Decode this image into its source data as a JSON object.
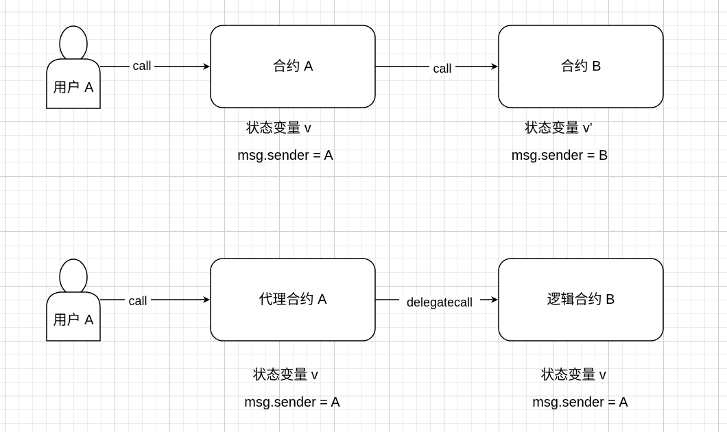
{
  "top_row": {
    "actor_label": "用户 A",
    "call_label_1": "call",
    "contract_a_label": "合约 A",
    "call_label_2": "call",
    "contract_b_label": "合约 B",
    "contract_a_state": "状态变量 v",
    "contract_a_sender": "msg.sender = A",
    "contract_b_state": "状态变量 v'",
    "contract_b_sender": "msg.sender = B"
  },
  "bottom_row": {
    "actor_label": "用户 A",
    "call_label": "call",
    "proxy_label": "代理合约 A",
    "delegatecall_label": "delegatecall",
    "logic_label": "逻辑合约 B",
    "proxy_state": "状态变量 v",
    "proxy_sender": "msg.sender = A",
    "logic_state": "状态变量 v",
    "logic_sender": "msg.sender = A"
  },
  "colors": {
    "background": "#ffffff",
    "grid": "#d0d0d0",
    "stroke": "#000000"
  }
}
